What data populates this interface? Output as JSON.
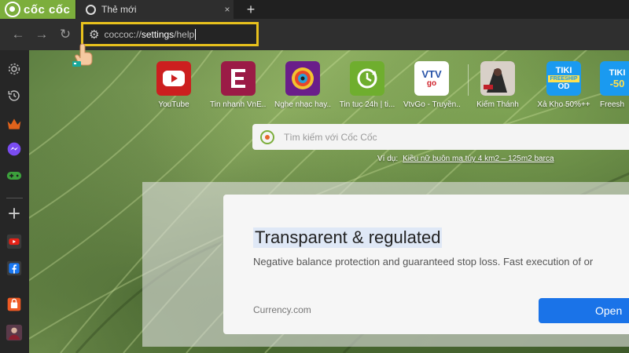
{
  "browser": {
    "brand": "cốc cốc",
    "tab_title": "Thẻ mới",
    "tab_close": "×",
    "new_tab_symbol": "+"
  },
  "toolbar": {
    "back": "←",
    "forward": "→",
    "reload": "↻",
    "url_host": "coccoc://",
    "url_path": "settings",
    "url_tail": "/help",
    "highlight_color": "#e8c11d"
  },
  "sidebar": {
    "items": [
      {
        "icon": "gear-icon"
      },
      {
        "icon": "history-icon"
      },
      {
        "icon": "crown-icon"
      },
      {
        "icon": "messenger-icon"
      },
      {
        "icon": "gamepad-icon"
      },
      {
        "icon": "plus-icon"
      },
      {
        "icon": "youtube-icon"
      },
      {
        "icon": "facebook-icon"
      },
      {
        "icon": "shopping-bag-icon"
      },
      {
        "icon": "game-avatar-icon"
      }
    ]
  },
  "speed_dials": [
    {
      "label": "YouTube",
      "icon": "youtube-icon",
      "color": "#cc1f1f"
    },
    {
      "label": "Tin nhanh VnE...",
      "icon": "vnexpress-icon",
      "color": "#9b1b46"
    },
    {
      "label": "Nghe nhạc hay...",
      "icon": "music-disc-icon",
      "color": "#6a1d8a"
    },
    {
      "label": "Tin tuc 24h | ti...",
      "icon": "clock-refresh-icon",
      "color": "#6fae2e"
    },
    {
      "label": "VtvGo - Truyền...",
      "icon": "vtvgo-icon",
      "color": "#ffffff"
    },
    {
      "label": "Kiếm Thánh",
      "icon": "game-poster-icon",
      "color": "#3a2a2a"
    },
    {
      "label": "Xả Kho 50%++",
      "icon": "tiki-freeship-icon",
      "color": "#1a9af0"
    },
    {
      "label": "Freesh",
      "icon": "tiki-sale-icon",
      "color": "#1a9af0"
    }
  ],
  "tiki": {
    "brand": "TIKI",
    "badge": "FREESHIP",
    "sub": "OD",
    "sale": "-50"
  },
  "vtv": {
    "logo": "VTV",
    "sub": "go"
  },
  "search": {
    "placeholder": "Tìm kiếm với Cốc Cốc",
    "example_prefix": "Ví dụ:",
    "example_link": "Kiều nữ buôn ma túy 4 km2 – 125m2 barca"
  },
  "ad": {
    "title": "Transparent & regulated",
    "description": "Negative balance protection and guaranteed stop loss. Fast execution of or",
    "source": "Currency.com",
    "button": "Open"
  }
}
